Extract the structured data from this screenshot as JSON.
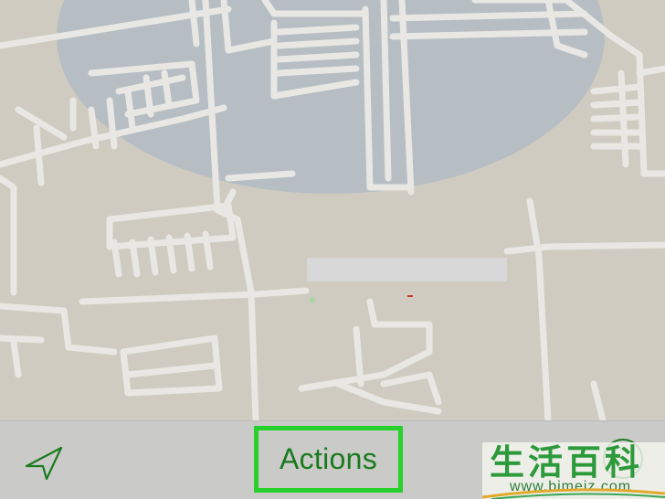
{
  "toolbar": {
    "locate_icon": "location-arrow-icon",
    "actions_label": "Actions",
    "info_icon": "info-icon",
    "highlight_color": "#27d12c",
    "tint_color": "#1a7a1e"
  },
  "map": {
    "land_color": "#cfcbc1",
    "road_color": "#e8e7e3",
    "accuracy_circle_color": "#b2bcc4"
  },
  "watermark": {
    "chinese_text": "生活百科",
    "url": "www.bimeiz.com"
  }
}
